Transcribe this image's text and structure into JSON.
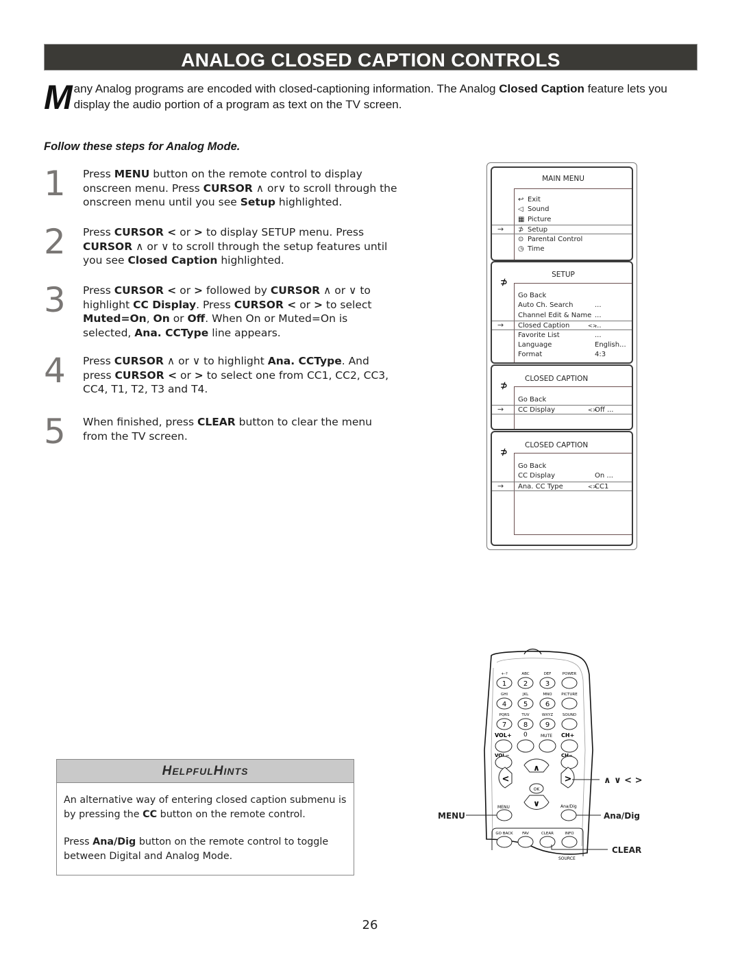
{
  "title": "ANALOG CLOSED CAPTION CONTROLS",
  "intro": {
    "dropcap": "M",
    "text_before": "any Analog programs are encoded with closed-captioning information. The Analog ",
    "bold": "Closed Caption",
    "text_after": " feature lets you display the audio portion of a program as text on the TV screen."
  },
  "steps_heading": "Follow these steps for Analog Mode.",
  "steps": [
    {
      "num": "1",
      "html": "Press <b>MENU</b> button on the remote control to display onscreen menu. Press <b>CURSOR</b> ∧ or∨ to scroll through the onscreen menu until you see <b>Setup</b> highlighted."
    },
    {
      "num": "2",
      "html": "Press <b>CURSOR &lt;</b> or <b>&gt;</b> to display SETUP menu. Press <b>CURSOR</b> ∧ or ∨ to scroll through the setup features until you see <b>Closed Caption</b> highlighted."
    },
    {
      "num": "3",
      "html": "Press <b>CURSOR &lt;</b> or <b>&gt;</b> followed by <b>CURSOR</b> ∧ or ∨ to highlight <b>CC Display</b>. Press <b>CURSOR &lt;</b> or <b>&gt;</b> to select <b>Muted=On</b>, <b>On</b> or <b>Off</b>. When On or Muted=On is selected, <b>Ana. CCType</b> line appears."
    },
    {
      "num": "4",
      "html": "Press <b>CURSOR</b> ∧ or ∨ to highlight <b>Ana. CCType</b>. And press <b>CURSOR &lt;</b> or <b>&gt;</b> to select one from CC1, CC2, CC3, CC4, T1, T2, T3 and T4."
    },
    {
      "num": "5",
      "html": "When finished, press <b>CLEAR</b> button to clear the menu from the TV screen."
    }
  ],
  "menus": {
    "main": {
      "title": "MAIN MENU",
      "items": [
        {
          "icon": "exit-icon",
          "glyph": "↩",
          "label": "Exit"
        },
        {
          "icon": "sound-icon",
          "glyph": "◁",
          "label": "Sound"
        },
        {
          "icon": "picture-icon",
          "glyph": "▦",
          "label": "Picture"
        },
        {
          "icon": "setup-icon",
          "glyph": "⊅",
          "label": "Setup",
          "selected": true
        },
        {
          "icon": "parental-icon",
          "glyph": "⊙",
          "label": "Parental Control"
        },
        {
          "icon": "time-icon",
          "glyph": "◷",
          "label": "Time"
        }
      ]
    },
    "setup": {
      "title": "SETUP",
      "items": [
        {
          "label": "Go Back",
          "arrows": "",
          "value": ""
        },
        {
          "label": "Auto Ch. Search",
          "arrows": "",
          "value": "..."
        },
        {
          "label": "Channel Edit & Name",
          "arrows": "",
          "value": "..."
        },
        {
          "label": "Closed Caption",
          "arrows": "<>",
          "value": "...",
          "selected": true
        },
        {
          "label": "Favorite List",
          "arrows": "",
          "value": "..."
        },
        {
          "label": "Language",
          "arrows": "",
          "value": "English..."
        },
        {
          "label": "Format",
          "arrows": "",
          "value": "4:3"
        }
      ]
    },
    "cc1": {
      "title": "CLOSED CAPTION",
      "items": [
        {
          "label": "Go Back",
          "arrows": "",
          "value": ""
        },
        {
          "label": "CC Display",
          "arrows": "<>",
          "value": "Off   ...",
          "selected": true
        }
      ]
    },
    "cc2": {
      "title": "CLOSED CAPTION",
      "items": [
        {
          "label": "Go Back",
          "arrows": "",
          "value": ""
        },
        {
          "label": "CC Display",
          "arrows": "",
          "value": "On   ..."
        },
        {
          "label": "Ana. CC Type",
          "arrows": "<>",
          "value": "CC1",
          "selected": true
        }
      ]
    },
    "pointer": "→"
  },
  "remote": {
    "keys": [
      {
        "top": "+-?",
        "label": "1"
      },
      {
        "top": "ABC",
        "label": "2"
      },
      {
        "top": "DEF",
        "label": "3"
      },
      {
        "top": "POWER",
        "label": ""
      },
      {
        "top": "GHI",
        "label": "4"
      },
      {
        "top": "JKL",
        "label": "5"
      },
      {
        "top": "MNO",
        "label": "6"
      },
      {
        "top": "PICTURE",
        "label": ""
      },
      {
        "top": "PQRS",
        "label": "7"
      },
      {
        "top": "TUV",
        "label": "8"
      },
      {
        "top": "WXYZ",
        "label": "9"
      },
      {
        "top": "SOUND",
        "label": ""
      }
    ],
    "vol_plus": "VOL+",
    "zero": "0",
    "mute": "MUTE",
    "ch_plus": "CH+",
    "vol_minus": "VOL−",
    "ch_minus": "CH−",
    "ok": "OK",
    "menu": "MENU",
    "ana_dig": "Ana/Dig",
    "bottom_keys": [
      "GO BACK",
      "FAV",
      "CLEAR",
      "INFO"
    ],
    "source": "SOURCE",
    "callouts": {
      "cursor": "∧  ∨  <  >",
      "menu": "MENU",
      "ana_dig": "Ana/Dig",
      "clear": "CLEAR"
    }
  },
  "hints": {
    "title_cap1": "H",
    "title_rest1": "ELPFUL ",
    "title_cap2": "H",
    "title_rest2": "INTS",
    "p1": "An alternative way of entering closed caption submenu is by pressing the <b>CC</b> button on the remote control.",
    "p2": "Press <b>Ana/Dig</b> button on the remote control to toggle between Digital and Analog Mode."
  },
  "page_number": "26"
}
